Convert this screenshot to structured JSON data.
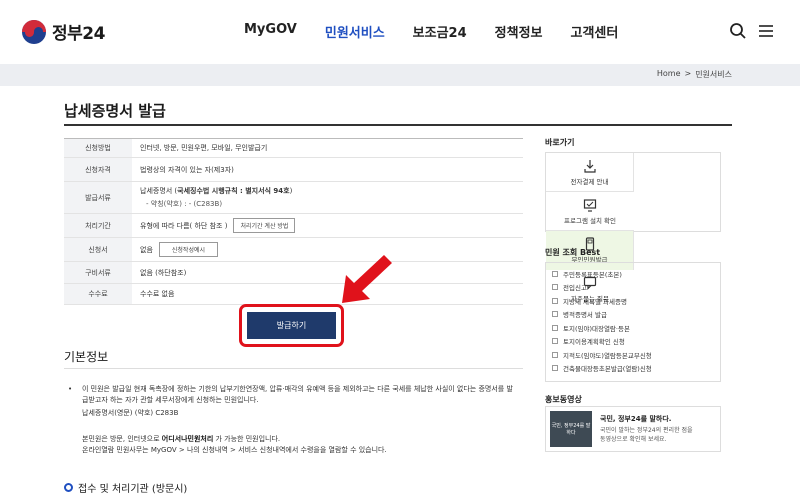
{
  "header": {
    "logo_text": "정부24",
    "nav": [
      "MyGOV",
      "민원서비스",
      "보조금24",
      "정책정보",
      "고객센터"
    ],
    "active_nav": "민원서비스"
  },
  "breadcrumb": {
    "home": "Home",
    "sep": ">",
    "current": "민원서비스"
  },
  "page_title": "납세증명서 발급",
  "info": {
    "rows": [
      {
        "label": "신청방법",
        "value": "인터넷, 방문, 민원우편, 모바일, 무인발급기"
      },
      {
        "label": "신청자격",
        "value": "법령상의 자격이 있는 자(제3자)"
      },
      {
        "label": "발급서류",
        "value_prefix": "납세증명서 (",
        "value_bold": "국세징수법 시행규칙 : 별지서식 94호",
        "value_suffix": ")",
        "sub": "- 약칭(약호) : - (C283B)"
      },
      {
        "label": "처리기간",
        "value": "유형에 따라 다름( 하단 참조 )",
        "button": "처리기간 계산 방법"
      },
      {
        "label": "신청서",
        "value": "없음",
        "button": "신청작성예시"
      },
      {
        "label": "구비서류",
        "value": "없음 (하단참조)"
      },
      {
        "label": "수수료",
        "value": "수수료 없음"
      }
    ],
    "issue_button": "발급하기"
  },
  "basic": {
    "title": "기본정보",
    "bullet": "•",
    "desc": "이 민원은 발급일 현재 독촉장에 정하는 기한의 납부기한연장액, 압류·매각의 유예액 등을 제외하고는 다른 국세를 체납한 사실이 없다는 증명서를 발급받고자 하는 자가 관할 세무서장에게 신청하는 민원입니다.",
    "name_line": "납세증명서(영문) (약호) C283B",
    "note_prefix": "본민원은 방문, 인터넷으로 ",
    "note_bold": "어디서나민원처리",
    "note_suffix": " 가 가능한 민원입니다.",
    "note2": "온라인열람 민원사무는 MyGOV > 나의 신청내역 > 서비스 신청내역에서 수령을을 열람할 수 있습니다.",
    "sub_section": "접수 및 처리기관 (방문시)"
  },
  "sidebar": {
    "quick_title": "바로가기",
    "quick": [
      {
        "label": "전자결제 안내",
        "icon": "download-icon"
      },
      {
        "label": "프로그램 설치 확인",
        "icon": "monitor-icon"
      },
      {
        "label": "무인민원발급",
        "icon": "kiosk-icon"
      },
      {
        "label": "자주묻는 질문",
        "icon": "chat-icon"
      }
    ],
    "best_title": "민원 조회 Best",
    "best": [
      "주민등록표등본(초본)",
      "전입신고",
      "지방세 세목별 과세증명",
      "병적증명서 발급",
      "토지(임야)대장열람·등본",
      "토지이용계획확인 신청",
      "지적도(임야도)열람등본교부신청",
      "건축물대장등초본발급(열람)신청"
    ],
    "promo_title": "홍보동영상",
    "promo_thumb": "국민, 정부24를 말하다",
    "promo_head": "국민, 정부24를 말하다.",
    "promo_line1": "국민이 말하는 정부24의 편리한 점을",
    "promo_line2": "동영상으로 확인해 보세요."
  },
  "colors": {
    "accent": "#1f4fc1",
    "button": "#1f3a6b",
    "highlight": "#e0121b"
  }
}
